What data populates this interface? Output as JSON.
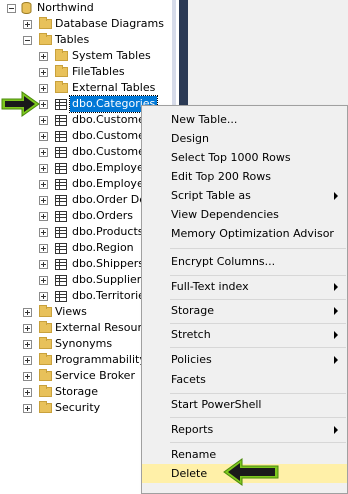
{
  "tree": {
    "root_label": "Northwind",
    "db_items": [
      {
        "label": "Database Diagrams"
      },
      {
        "label": "Tables"
      }
    ],
    "table_children": [
      {
        "label": "System Tables"
      },
      {
        "label": "FileTables"
      },
      {
        "label": "External Tables"
      }
    ],
    "tables": [
      {
        "label": "dbo.Categories"
      },
      {
        "label": "dbo.Customer"
      },
      {
        "label": "dbo.Customer"
      },
      {
        "label": "dbo.Customer"
      },
      {
        "label": "dbo.Employee"
      },
      {
        "label": "dbo.Employee"
      },
      {
        "label": "dbo.Order Det"
      },
      {
        "label": "dbo.Orders"
      },
      {
        "label": "dbo.Products"
      },
      {
        "label": "dbo.Region"
      },
      {
        "label": "dbo.Shippers"
      },
      {
        "label": "dbo.Suppliers"
      },
      {
        "label": "dbo.Territories"
      }
    ],
    "bottom_items": [
      {
        "label": "Views"
      },
      {
        "label": "External Resources"
      },
      {
        "label": "Synonyms"
      },
      {
        "label": "Programmability"
      },
      {
        "label": "Service Broker"
      },
      {
        "label": "Storage"
      },
      {
        "label": "Security"
      }
    ]
  },
  "context_menu": {
    "new_table": "New Table...",
    "design": "Design",
    "select_top": "Select Top 1000 Rows",
    "edit_top": "Edit Top 200 Rows",
    "script_table": "Script Table as",
    "view_dependencies": "View Dependencies",
    "memory_opt": "Memory Optimization Advisor",
    "encrypt": "Encrypt Columns...",
    "fulltext": "Full-Text index",
    "storage": "Storage",
    "stretch": "Stretch",
    "policies": "Policies",
    "facets": "Facets",
    "powershell": "Start PowerShell",
    "reports": "Reports",
    "rename": "Rename",
    "delete": "Delete"
  },
  "colors": {
    "arrow": "#7ec81e",
    "selection": "#0078d7",
    "highlight": "#fff0a8"
  }
}
